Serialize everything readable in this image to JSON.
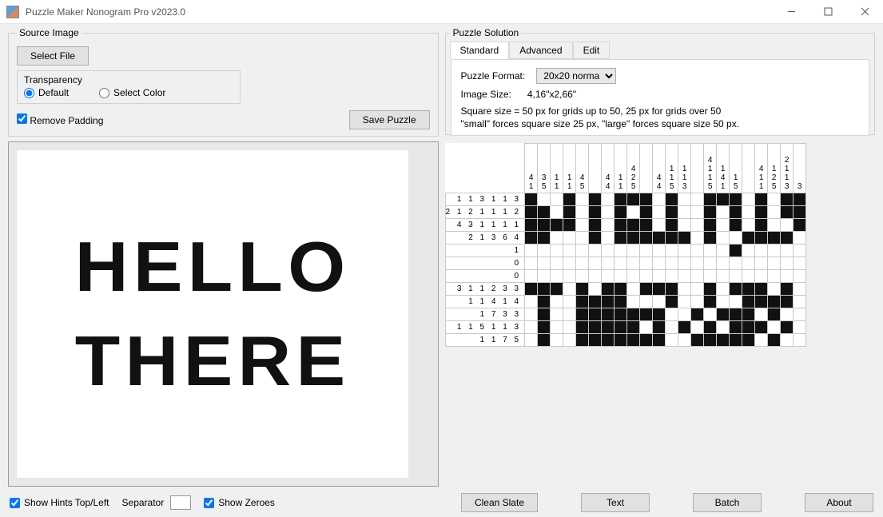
{
  "window": {
    "title": "Puzzle Maker Nonogram Pro v2023.0"
  },
  "source": {
    "legend": "Source Image",
    "select_file": "Select File",
    "transparency_label": "Transparency",
    "radio_default": "Default",
    "radio_select_color": "Select Color",
    "remove_padding": "Remove Padding",
    "remove_padding_checked": true,
    "save_puzzle": "Save Puzzle",
    "preview_line1": "HELLO",
    "preview_line2": "THERE"
  },
  "solution": {
    "legend": "Puzzle Solution",
    "tabs": {
      "standard": "Standard",
      "advanced": "Advanced",
      "edit": "Edit"
    },
    "format_label": "Puzzle Format:",
    "format_value": "20x20 normal",
    "size_label": "Image Size:",
    "size_value": "4,16\"x2,66\"",
    "hint1": "Square size = 50 px for grids up to 50, 25 px for grids over 50",
    "hint2": "\"small\" forces square size 25 px, \"large\" forces square size 50 px."
  },
  "nonogram": {
    "col_clues": [
      [
        4,
        1
      ],
      [
        3,
        5
      ],
      [
        1,
        1
      ],
      [
        1,
        1
      ],
      [
        4,
        5
      ],
      [],
      [
        4,
        4
      ],
      [
        1,
        1
      ],
      [
        4,
        2,
        5
      ],
      [],
      [
        4,
        4
      ],
      [
        1,
        1,
        5
      ],
      [
        1,
        1,
        3
      ],
      [],
      [
        4,
        1,
        1,
        5
      ],
      [
        1,
        4,
        1
      ],
      [
        1,
        5
      ],
      [],
      [
        4,
        1,
        1
      ],
      [
        1,
        2,
        5
      ],
      [
        2,
        1,
        1,
        3
      ],
      [
        3
      ]
    ],
    "row_clues": [
      [
        1,
        1,
        3,
        1,
        1,
        3
      ],
      [
        2,
        1,
        2,
        1,
        1,
        1,
        2
      ],
      [
        4,
        3,
        1,
        1,
        1,
        1
      ],
      [
        2,
        1,
        3,
        6,
        4
      ],
      [
        1
      ],
      [
        0
      ],
      [
        0
      ],
      [
        3,
        1,
        1,
        2,
        3,
        3
      ],
      [
        1,
        1,
        4,
        1,
        4
      ],
      [
        1,
        7,
        3,
        3
      ],
      [
        1,
        1,
        5,
        1,
        1,
        3
      ],
      [
        1,
        1,
        7,
        5
      ]
    ],
    "grid": [
      "1001010111010011101011",
      "1101010101010010101011",
      "1111010111010010101001",
      "1100010111111010011110",
      "0000000000000000100000",
      "0000000000000000000000",
      "0000000000000000000000",
      "1110101101110010111010",
      "0100111100010010011110",
      "0100111111100101110100",
      "0100111110101010111010",
      "0100111111100111110100"
    ]
  },
  "bottom": {
    "show_hints": "Show Hints Top/Left",
    "show_hints_checked": true,
    "separator_label": "Separator",
    "separator_value": "",
    "show_zeroes": "Show Zeroes",
    "show_zeroes_checked": true,
    "clean_slate": "Clean Slate",
    "text": "Text",
    "batch": "Batch",
    "about": "About"
  }
}
